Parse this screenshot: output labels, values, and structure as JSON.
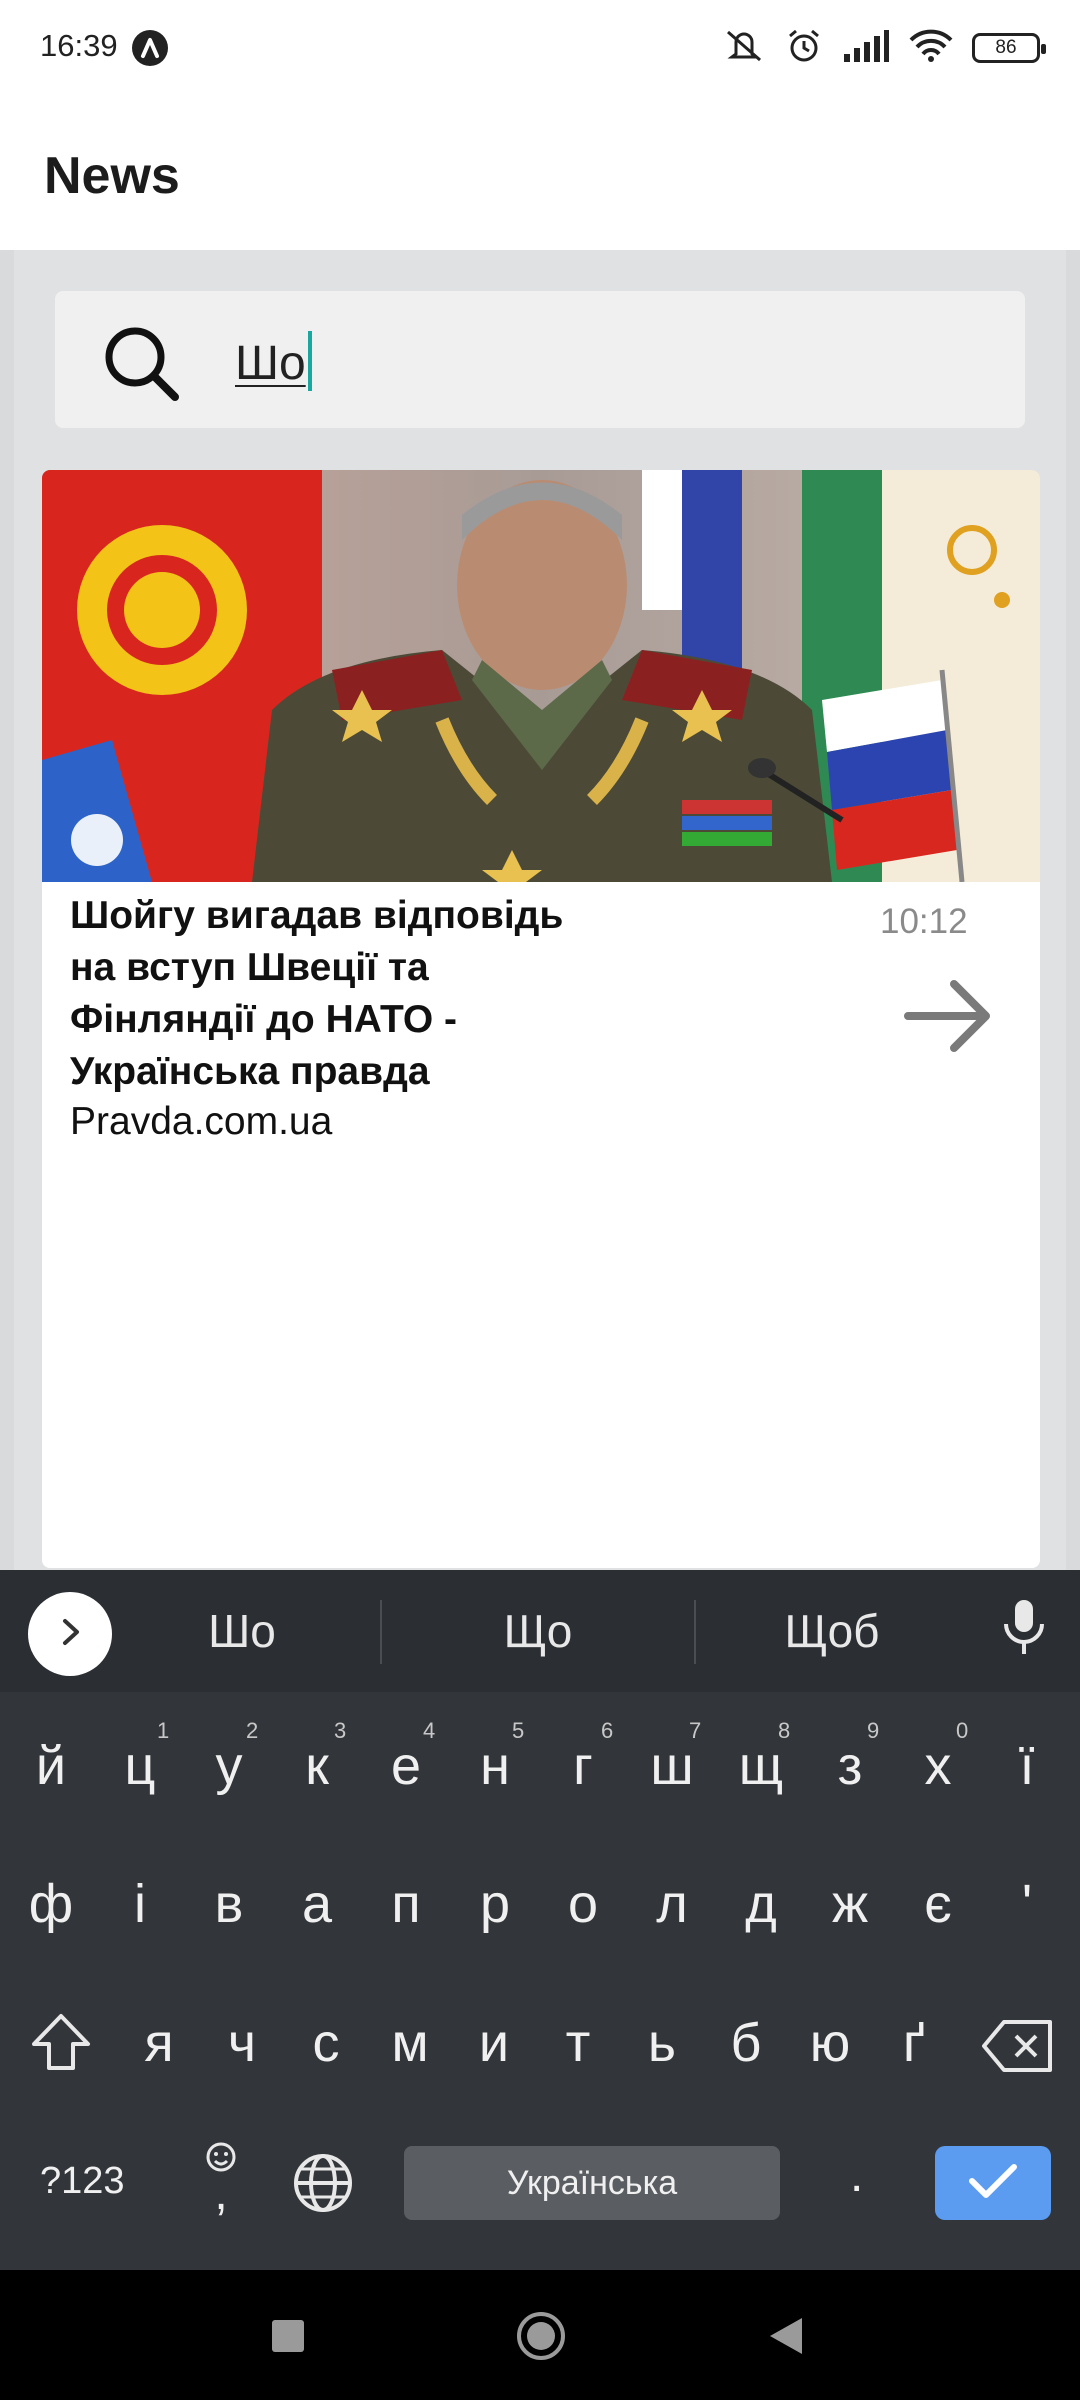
{
  "status_bar": {
    "time": "16:39",
    "battery": "86"
  },
  "app_bar": {
    "title": "News"
  },
  "search": {
    "value": "Шо"
  },
  "card": {
    "title": "Шойгу вигадав відповідь\nна вступ Швеції та\nФінляндії до НАТО -\nУкраїнська правда",
    "source": "Pravda.com.ua",
    "time": "10:12"
  },
  "keyboard": {
    "suggestions": [
      "Шо",
      "Що",
      "Щоб"
    ],
    "row1": [
      "й",
      "ц",
      "у",
      "к",
      "е",
      "н",
      "г",
      "ш",
      "щ",
      "з",
      "х",
      "ї"
    ],
    "row1_hints": [
      "1",
      "2",
      "3",
      "4",
      "5",
      "6",
      "7",
      "8",
      "9",
      "0"
    ],
    "row2": [
      "ф",
      "і",
      "в",
      "а",
      "п",
      "р",
      "о",
      "л",
      "д",
      "ж",
      "є",
      "'"
    ],
    "row3": [
      "я",
      "ч",
      "с",
      "м",
      "и",
      "т",
      "ь",
      "б",
      "ю",
      "ґ"
    ],
    "symbols_label": "?123",
    "comma_label": ",",
    "period_label": ".",
    "space_label": "Українська"
  }
}
